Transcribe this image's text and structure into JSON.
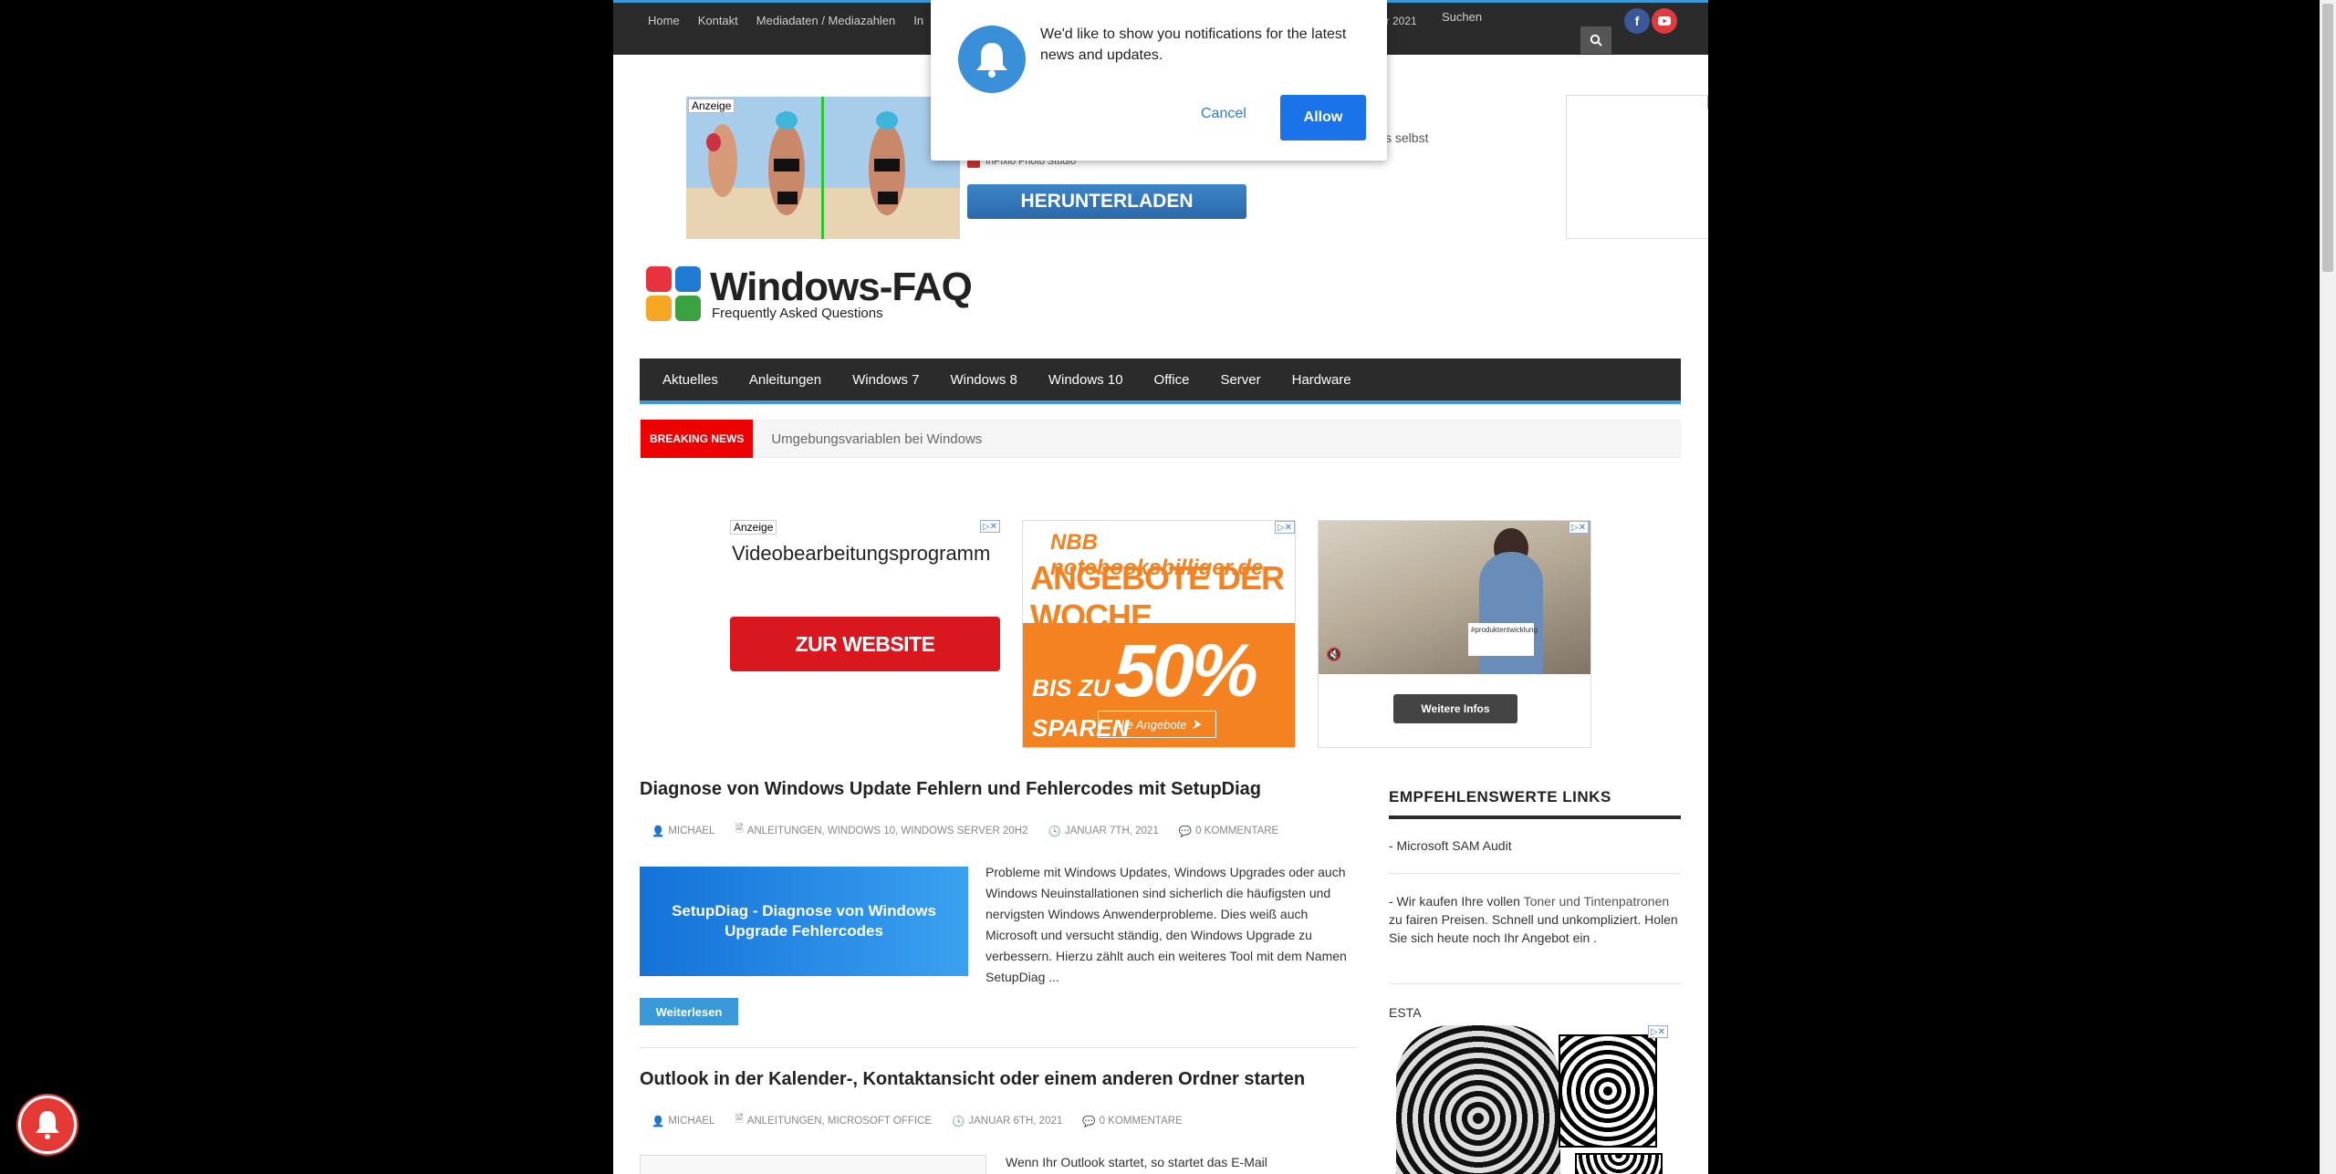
{
  "topbar": {
    "nav": [
      "Home",
      "Kontakt",
      "Mediadaten / Mediazahlen",
      "In"
    ],
    "date_fragment": "ar 2021",
    "search_label": "Suchen",
    "search_icon": "search-icon",
    "social": [
      "facebook-icon",
      "youtube-icon"
    ]
  },
  "notification": {
    "message": "We'd like to show you notifications for the latest news and updates.",
    "cancel_label": "Cancel",
    "allow_label": "Allow",
    "icon": "bell-icon"
  },
  "ad_top": {
    "anzeige": "Anzeige",
    "brand": "InPixio Photo Studio",
    "button": "HERUNTERLADEN",
    "text_fragment": "s selbst"
  },
  "logo": {
    "title": "Windows-FAQ",
    "subtitle": "Frequently Asked Questions",
    "colors": [
      "#e8333f",
      "#1f7ad2",
      "#f5a623",
      "#3aa33f"
    ]
  },
  "main_nav": [
    "Aktuelles",
    "Anleitungen",
    "Windows 7",
    "Windows 8",
    "Windows 10",
    "Office",
    "Server",
    "Hardware"
  ],
  "breaking": {
    "label": "BREAKING NEWS",
    "text": "Umgebungsvariablen bei Windows"
  },
  "ads_row": {
    "ad1": {
      "anzeige": "Anzeige",
      "text": "Videobearbeitungsprogramm",
      "button": "ZUR WEBSITE"
    },
    "ad2": {
      "brand": "NBB notebooksbilliger.de",
      "title": "ANGEBOTE DER WOCHE",
      "bis_zu": "BIS ZU",
      "percent": "50%",
      "sparen": "SPAREN",
      "button": "Alle Angebote"
    },
    "ad3": {
      "overlay_tag": "#produktentwicklung",
      "button": "Weitere Infos"
    }
  },
  "articles": [
    {
      "title": "Diagnose von Windows Update Fehlern und Fehlercodes mit SetupDiag",
      "author": "MICHAEL",
      "categories": "ANLEITUNGEN, WINDOWS 10, WINDOWS SERVER 20H2",
      "date": "JANUAR 7TH, 2021",
      "comments": "0 KOMMENTARE",
      "thumb_text": "SetupDiag - Diagnose von Windows Upgrade Fehlercodes",
      "excerpt": "Probleme mit Windows Updates, Windows Upgrades oder auch Windows Neuinstallationen sind sicherlich die häufigsten und nervigsten Windows Anwenderprobleme. Dies weiß auch Microsoft und versucht ständig, den Windows Upgrade zu verbessern. Hierzu zählt auch ein weiteres Tool mit dem Namen SetupDiag ...",
      "more_label": "Weiterlesen"
    },
    {
      "title": "Outlook in der Kalender-, Kontaktansicht oder einem anderen Ordner starten",
      "author": "MICHAEL",
      "categories": "ANLEITUNGEN, MICROSOFT OFFICE",
      "date": "JANUAR 6TH, 2021",
      "comments": "0 KOMMENTARE",
      "excerpt": "Wenn Ihr Outlook startet, so startet das E-Mail"
    }
  ],
  "sidebar": {
    "heading": "EMPFEHLENSWERTE LINKS",
    "link1": "- Microsoft SAM Audit",
    "link2_pre": "- Wir kaufen Ihre vollen ",
    "link2_a": "Toner und Tintenpatronen",
    "link2_post": " zu fairen Preisen. Schnell und unkompliziert. Holen Sie sich heute noch Ihr Angebot ein .",
    "esta": "ESTA"
  }
}
